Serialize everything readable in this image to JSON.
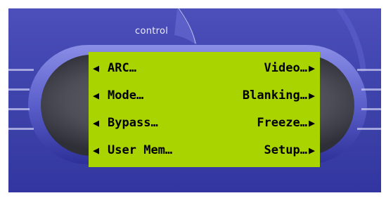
{
  "panel": {
    "label": "control"
  },
  "icons": {
    "left_arrow": "◀",
    "right_arrow": "▶"
  },
  "colors": {
    "lcd_background": "#a9d400",
    "lcd_text": "#000000",
    "device_body": "#4346b0"
  },
  "menu": {
    "rows": [
      {
        "left": "ARC…",
        "right": "Video…"
      },
      {
        "left": "Mode…",
        "right": "Blanking…"
      },
      {
        "left": "Bypass…",
        "right": "Freeze…"
      },
      {
        "left": "User Mem…",
        "right": "Setup…"
      }
    ]
  }
}
